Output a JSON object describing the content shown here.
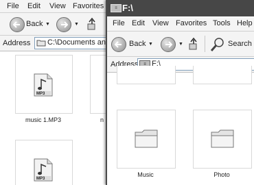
{
  "back_window": {
    "menu": [
      "File",
      "Edit",
      "View",
      "Favorites"
    ],
    "toolbar": {
      "back_label": "Back"
    },
    "address": {
      "label": "Address",
      "value": "C:\\Documents and S"
    },
    "files": [
      {
        "name": "music 1.MP3",
        "badge": "MP3"
      },
      {
        "name": "n",
        "badge": ""
      },
      {
        "name": "",
        "badge": "MP3"
      }
    ]
  },
  "front_window": {
    "title": "F:\\",
    "menu": [
      "File",
      "Edit",
      "View",
      "Favorites",
      "Tools",
      "Help"
    ],
    "toolbar": {
      "back_label": "Back",
      "search_label": "Search"
    },
    "address": {
      "label": "Address",
      "value": "F:\\"
    },
    "folders": [
      {
        "name": "Music"
      },
      {
        "name": "Photo"
      }
    ]
  }
}
